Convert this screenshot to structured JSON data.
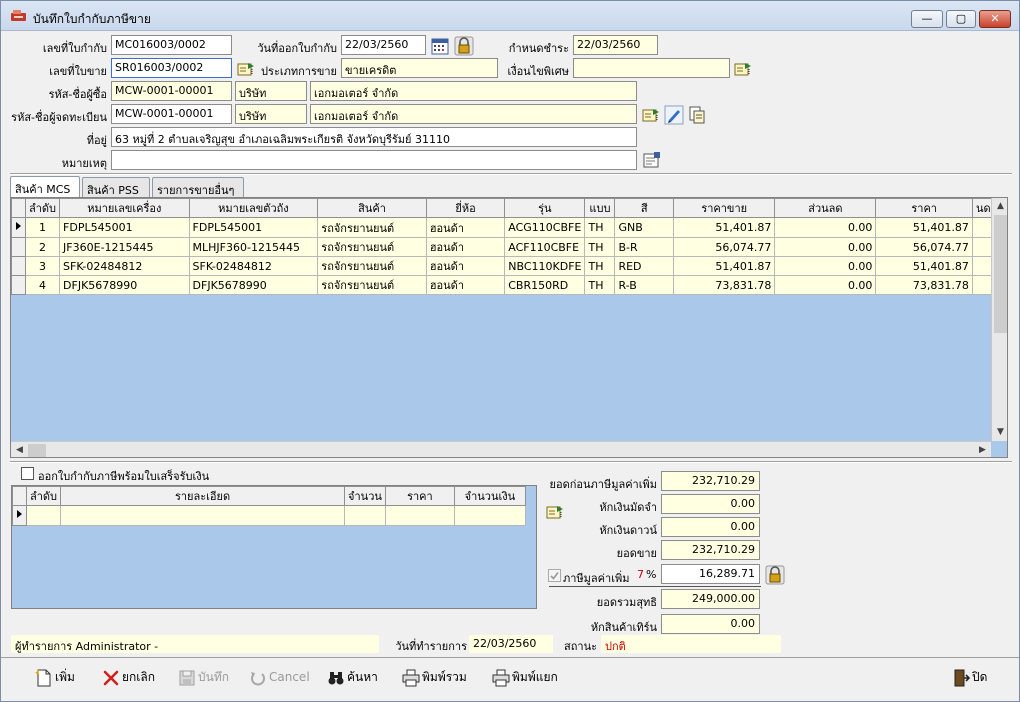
{
  "window": {
    "title": "บันทึกใบกำกับภาษีขาย",
    "min_glyph": "—",
    "max_glyph": "▢",
    "close_glyph": "✕"
  },
  "header": {
    "invoice_no_label": "เลขที่ใบกำกับ",
    "invoice_no": "MC016003/0002",
    "issue_date_label": "วันที่ออกใบกำกับ",
    "issue_date": "22/03/2560",
    "due_date_label": "กำหนดชำระ",
    "due_date": "22/03/2560",
    "sales_no_label": "เลขที่ใบขาย",
    "sales_no": "SR016003/0002",
    "sale_type_label": "ประเภทการขาย",
    "sale_type": "ขายเครดิต",
    "special_cond_label": "เงื่อนไขพิเศษ",
    "special_cond": "",
    "buyer_label": "รหัส-ชื่อผู้ซื้อ",
    "buyer_code": "MCW-0001-00001",
    "buyer_prefix": "บริษัท",
    "buyer_name": "เอกมอเตอร์ จำกัด",
    "registrant_label": "รหัส-ชื่อผู้จดทะเบียน",
    "registrant_code": "MCW-0001-00001",
    "registrant_prefix": "บริษัท",
    "registrant_name": "เอกมอเตอร์ จำกัด",
    "address_label": "ที่อยู่",
    "address": "63 หมู่ที่ 2 ตำบลเจริญสุข อำเภอเฉลิมพระเกียรติ จังหวัดบุรีรัมย์ 31110",
    "note_label": "หมายเหตุ",
    "note": ""
  },
  "tabs": [
    {
      "label": "สินค้า MCS",
      "active": true
    },
    {
      "label": "สินค้า PSS",
      "active": false
    },
    {
      "label": "รายการขายอื่นๆ",
      "active": false
    }
  ],
  "items_table": {
    "columns": [
      "ลำดับ",
      "หมายเลขเครื่อง",
      "หมายเลขตัวถัง",
      "สินค้า",
      "ยี่ห้อ",
      "รุ่น",
      "แบบ",
      "สี",
      "ราคาขาย",
      "ส่วนลด",
      "ราคา",
      "นดาว"
    ],
    "rows": [
      [
        "1",
        "FDPL545001",
        "FDPL545001",
        "รถจักรยานยนต์",
        "ฮอนด้า",
        "ACG110CBFE",
        "TH",
        "GNB",
        "51,401.87",
        "0.00",
        "51,401.87",
        ""
      ],
      [
        "2",
        "JF360E-1215445",
        "MLHJF360-1215445",
        "รถจักรยานยนต์",
        "ฮอนด้า",
        "ACF110CBFE",
        "TH",
        "B-R",
        "56,074.77",
        "0.00",
        "56,074.77",
        ""
      ],
      [
        "3",
        "SFK-02484812",
        "SFK-02484812",
        "รถจักรยานยนต์",
        "ฮอนด้า",
        "NBC110KDFE",
        "TH",
        "RED",
        "51,401.87",
        "0.00",
        "51,401.87",
        ""
      ],
      [
        "4",
        "DFJK5678990",
        "DFJK5678990",
        "รถจักรยานยนต์",
        "ฮอนด้า",
        "CBR150RD",
        "TH",
        "R-B",
        "73,831.78",
        "0.00",
        "73,831.78",
        ""
      ]
    ]
  },
  "receipt": {
    "checkbox_label": "ออกใบกำกับภาษีพร้อมใบเสร็จรับเงิน",
    "columns": [
      "ลำดับ",
      "รายละเอียด",
      "จำนวน",
      "ราคา",
      "จำนวนเงิน"
    ]
  },
  "summary": {
    "pre_vat_label": "ยอดก่อนภาษีมูลค่าเพิ่ม",
    "pre_vat": "232,710.29",
    "deposit_label": "หักเงินมัดจำ",
    "deposit": "0.00",
    "down_label": "หักเงินดาวน์",
    "down": "0.00",
    "sales_label": "ยอดขาย",
    "sales": "232,710.29",
    "vat_label": "ภาษีมูลค่าเพิ่ม",
    "vat_rate": "7",
    "vat_pct": "%",
    "vat": "16,289.71",
    "net_label": "ยอดรวมสุทธิ",
    "net": "249,000.00",
    "trade_in_label": "หักสินค้าเทิร์น",
    "trade_in": "0.00"
  },
  "status": {
    "operator_label": "ผู้ทำรายการ",
    "operator": "Administrator -",
    "txn_date_label": "วันที่ทำรายการ",
    "txn_date": "22/03/2560",
    "state_label": "สถานะ",
    "state": "ปกติ"
  },
  "toolbar": {
    "add": "เพิ่ม",
    "cancel_th": "ยกเลิก",
    "save": "บันทึก",
    "cancel_en": "Cancel",
    "search": "ค้นหา",
    "print_all": "พิมพ์รวม",
    "print_split": "พิมพ์แยก",
    "close": "ปิด"
  },
  "colors": {
    "readonly_bg": "#ffffe1",
    "grid_bg": "#a9c8ea",
    "state_text": "#cc0000",
    "vat_rate_text": "#cc0000"
  }
}
